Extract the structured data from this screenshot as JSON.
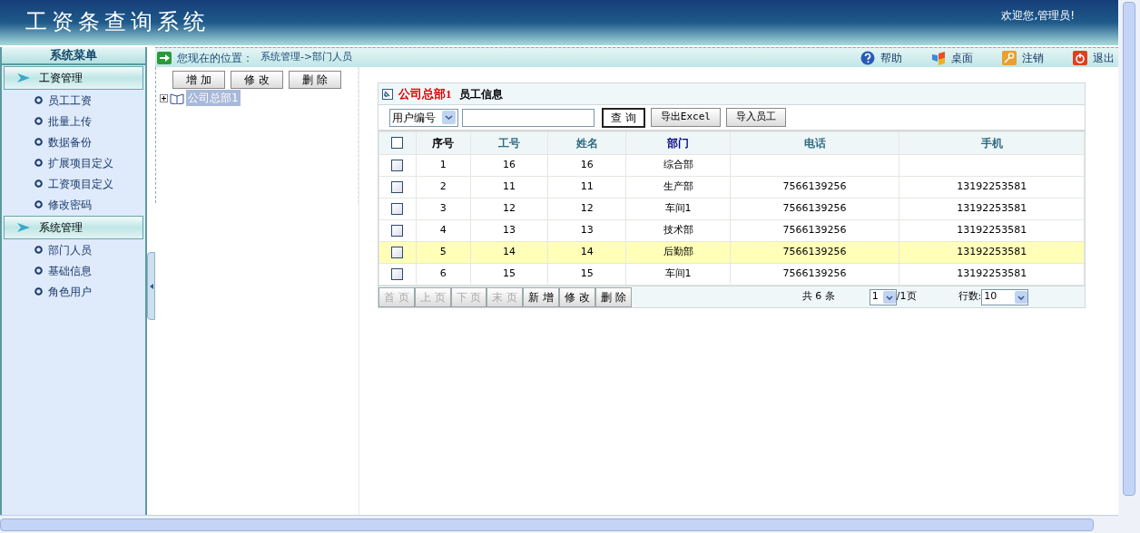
{
  "header": {
    "title": "工资条查询系统",
    "welcome": "欢迎您,管理员!"
  },
  "sidebar": {
    "title": "系统菜单",
    "groups": [
      {
        "label": "工资管理",
        "items": [
          "员工工资",
          "批量上传",
          "数据备份",
          "扩展项目定义",
          "工资项目定义",
          "修改密码"
        ]
      },
      {
        "label": "系统管理",
        "items": [
          "部门人员",
          "基础信息",
          "角色用户"
        ]
      }
    ]
  },
  "breadcrumb": {
    "label": "您现在的位置：",
    "path": "系统管理->部门人员"
  },
  "toolbar_links": [
    {
      "kind": "help",
      "label": "帮助"
    },
    {
      "kind": "desktop",
      "label": "桌面"
    },
    {
      "kind": "logout",
      "label": "注销"
    },
    {
      "kind": "exit",
      "label": "退出"
    }
  ],
  "tree": {
    "buttons": [
      "增 加",
      "修 改",
      "删 除"
    ],
    "nodes": [
      {
        "label": "公司总部1",
        "selected": true,
        "expanded": false
      }
    ]
  },
  "panel": {
    "department": "公司总部1",
    "title": "员工信息",
    "select_all_checked": false,
    "search": {
      "field": "用户编号",
      "buttons": [
        "查 询",
        "导出Excel",
        "导入员工"
      ]
    },
    "columns": [
      "序号",
      "工号",
      "姓名",
      "部门",
      "电话",
      "手机"
    ],
    "rows": [
      {
        "cells": [
          "1",
          "16",
          "16",
          "综合部",
          "",
          ""
        ],
        "checked": false,
        "highlighted": false
      },
      {
        "cells": [
          "2",
          "11",
          "11",
          "生产部",
          "7566139256",
          "13192253581"
        ],
        "checked": false,
        "highlighted": false
      },
      {
        "cells": [
          "3",
          "12",
          "12",
          "车间1",
          "7566139256",
          "13192253581"
        ],
        "checked": false,
        "highlighted": false
      },
      {
        "cells": [
          "4",
          "13",
          "13",
          "技术部",
          "7566139256",
          "13192253581"
        ],
        "checked": false,
        "highlighted": false
      },
      {
        "cells": [
          "5",
          "14",
          "14",
          "后勤部",
          "7566139256",
          "13192253581"
        ],
        "checked": false,
        "highlighted": true
      },
      {
        "cells": [
          "6",
          "15",
          "15",
          "车间1",
          "7566139256",
          "13192253581"
        ],
        "checked": false,
        "highlighted": false
      }
    ],
    "pager": {
      "buttons": [
        {
          "label": "首 页",
          "disabled": true
        },
        {
          "label": "上 页",
          "disabled": true
        },
        {
          "label": "下 页",
          "disabled": true
        },
        {
          "label": "末 页",
          "disabled": true
        },
        {
          "label": "新 增",
          "disabled": false
        },
        {
          "label": "修 改",
          "disabled": false
        },
        {
          "label": "删 除",
          "disabled": false
        }
      ],
      "total": "共 6 条",
      "page": "1",
      "pages": "/1页",
      "rows_label": "行数:",
      "rows_value": "10"
    }
  }
}
